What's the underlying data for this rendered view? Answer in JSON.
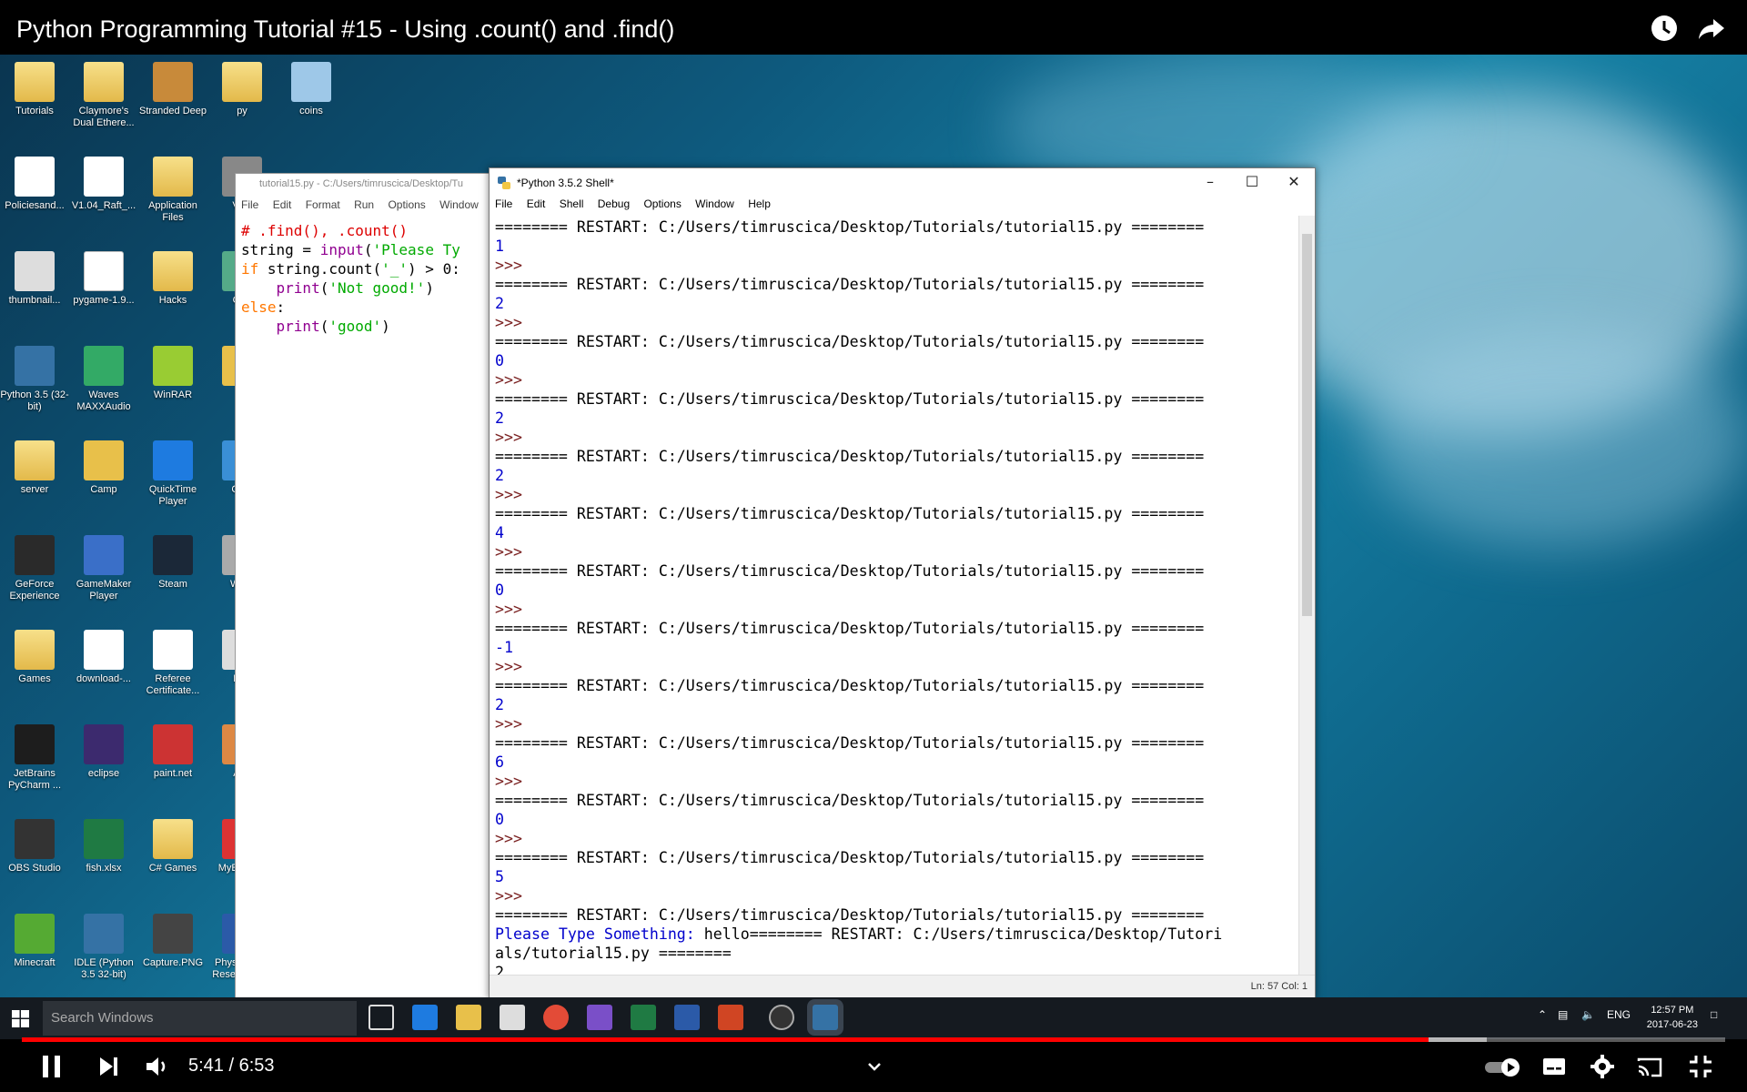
{
  "video": {
    "title": "Python Programming Tutorial #15 - Using .count() and .find()",
    "time_current": "5:41",
    "time_separator": "/",
    "time_total": "6:53",
    "progress_fraction": 0.826,
    "buffered_fraction": 0.86
  },
  "desktop_icons": [
    {
      "label": "Tutorials"
    },
    {
      "label": "Claymore's Dual Ethere..."
    },
    {
      "label": "Stranded Deep"
    },
    {
      "label": "py"
    },
    {
      "label": "coins"
    },
    {
      "label": "Policiesand..."
    },
    {
      "label": "V1.04_Raft_..."
    },
    {
      "label": "Application Files"
    },
    {
      "label": "Visu"
    },
    {
      "label": "thumbnail..."
    },
    {
      "label": "pygame-1.9..."
    },
    {
      "label": "Hacks"
    },
    {
      "label": "Goo"
    },
    {
      "label": "Python 3.5 (32-bit)"
    },
    {
      "label": "Waves MAXXAudio"
    },
    {
      "label": "WinRAR"
    },
    {
      "label": "Py"
    },
    {
      "label": "server"
    },
    {
      "label": "Camp"
    },
    {
      "label": "QuickTime Player"
    },
    {
      "label": "CDB"
    },
    {
      "label": "GeForce Experience"
    },
    {
      "label": "GameMaker Player"
    },
    {
      "label": "Steam"
    },
    {
      "label": "Wo T"
    },
    {
      "label": "Games"
    },
    {
      "label": "download-..."
    },
    {
      "label": "Referee Certificate..."
    },
    {
      "label": "Rec"
    },
    {
      "label": "JetBrains PyCharm ..."
    },
    {
      "label": "eclipse"
    },
    {
      "label": "paint.net"
    },
    {
      "label": "Afte"
    },
    {
      "label": "OBS Studio"
    },
    {
      "label": "fish.xlsx"
    },
    {
      "label": "C# Games"
    },
    {
      "label": "MyEt Oper"
    },
    {
      "label": "Minecraft"
    },
    {
      "label": "IDLE (Python 3.5 32-bit)"
    },
    {
      "label": "Capture.PNG"
    },
    {
      "label": "Physics Fair Research.d..."
    }
  ],
  "editor": {
    "title": "tutorial15.py - C:/Users/timruscica/Desktop/Tu",
    "menu": [
      "File",
      "Edit",
      "Format",
      "Run",
      "Options",
      "Window"
    ],
    "code": {
      "l1_comment": "# .find(), .count()",
      "l2_a": "string = ",
      "l2_builtin": "input",
      "l2_b": "(",
      "l2_str": "'Please Ty",
      "l3_kw": "if",
      "l3_a": " string.count(",
      "l3_str": "'_'",
      "l3_b": ") > 0:",
      "l4_indent": "    ",
      "l4_builtin": "print",
      "l4_a": "(",
      "l4_str": "'Not good!'",
      "l4_b": ")",
      "l5_kw": "else",
      "l5_a": ":",
      "l6_indent": "    ",
      "l6_builtin": "print",
      "l6_a": "(",
      "l6_str": "'good'",
      "l6_b": ")"
    }
  },
  "shell": {
    "title": "*Python 3.5.2 Shell*",
    "menu": [
      "File",
      "Edit",
      "Shell",
      "Debug",
      "Options",
      "Window",
      "Help"
    ],
    "restart_line": "======== RESTART: C:/Users/timruscica/Desktop/Tutorials/tutorial15.py ========",
    "prompt": ">>>",
    "outputs": [
      "1",
      "2",
      "0",
      "2",
      "2",
      "4",
      "0",
      "-1",
      "2",
      "6",
      "0",
      "5"
    ],
    "last_prompt_label": "Please Type Something: ",
    "last_input_line": "hello======== RESTART: C:/Users/timruscica/Desktop/Tutori",
    "last_input_wrap": "als/tutorial15.py ========",
    "last_output": "2",
    "status": "Ln: 57   Col: 1"
  },
  "taskbar": {
    "search_placeholder": "Search Windows",
    "lang": "ENG",
    "clock_time": "12:57 PM",
    "clock_date": "2017-06-23"
  },
  "colors": {
    "progress": "#ff0000",
    "idle_output": "#0000cc",
    "idle_prompt": "#7a2020"
  }
}
